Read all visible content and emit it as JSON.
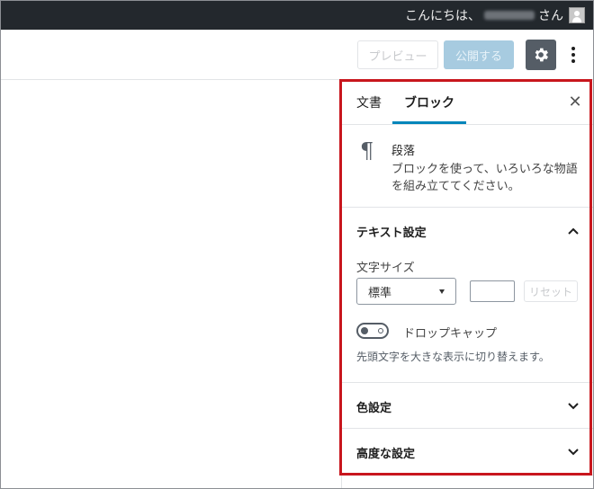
{
  "admin_bar": {
    "greeting_prefix": "こんにちは、",
    "greeting_suffix": "さん",
    "avatar_icon": "user-avatar-icon"
  },
  "toolbar": {
    "preview_label": "プレビュー",
    "publish_label": "公開する",
    "settings_icon": "gear-icon",
    "more_icon": "vertical-ellipsis-icon"
  },
  "sidebar": {
    "tabs": [
      {
        "label": "文書",
        "active": false
      },
      {
        "label": "ブロック",
        "active": true
      }
    ],
    "close_icon": "close-icon",
    "block_card": {
      "icon": "paragraph-icon",
      "title": "段落",
      "description": "ブロックを使って、いろいろな物語を組み立ててください。"
    },
    "text_settings": {
      "title": "テキスト設定",
      "expanded": true,
      "font_size_label": "文字サイズ",
      "font_size_selected": "標準",
      "custom_size_value": "",
      "reset_label": "リセット",
      "drop_cap_label": "ドロップキャップ",
      "drop_cap_enabled": false,
      "drop_cap_help": "先頭文字を大きな表示に切り替えます。"
    },
    "color_settings": {
      "title": "色設定",
      "expanded": false
    },
    "advanced": {
      "title": "高度な設定",
      "expanded": false
    }
  },
  "colors": {
    "admin_bar_bg": "#23282d",
    "accent_tab": "#0085ba",
    "publish_bg": "#a7cbe0",
    "highlight_border": "#c8161d"
  }
}
